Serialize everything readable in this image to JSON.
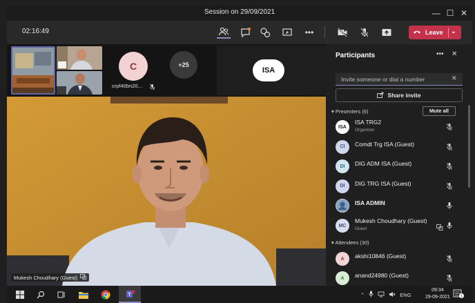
{
  "window": {
    "title": "Session on 29/09/2021",
    "controls": [
      "—",
      "☐",
      "✕"
    ]
  },
  "toolbar": {
    "timer": "02:16:49",
    "leave_label": "Leave",
    "icons": [
      "people-icon",
      "chat-icon",
      "reactions-icon",
      "share-screen-icon",
      "more-icon",
      "camera-off-icon",
      "mic-off-icon",
      "share-tray-icon"
    ]
  },
  "stage": {
    "tile_c": {
      "initial": "C",
      "name": "crpf40bn20..."
    },
    "overflow": "+25",
    "tile_isa": {
      "initial": "ISA"
    },
    "main_speaker": "Mukesh Choudhary (Guest)"
  },
  "panel": {
    "title": "Participants",
    "invite_placeholder": "Invite someone or dial a number",
    "share_invite": "Share invite",
    "presenters_header": "Presenters (6)",
    "mute_all": "Mute all",
    "attendees_header": "Attendees (30)",
    "presenters": [
      {
        "initials": "ISA",
        "name": "ISA TRG2",
        "sub": "Organizer",
        "bg": "#ffffff",
        "fg": "#111111",
        "mic": "muted"
      },
      {
        "initials": "CI",
        "name": "Comdt Trg ISA (Guest)",
        "sub": "",
        "bg": "#cfd6ec",
        "fg": "#3b4a7a",
        "mic": "muted"
      },
      {
        "initials": "DI",
        "name": "DIG ADM ISA (Guest)",
        "sub": "",
        "bg": "#cfe5f0",
        "fg": "#2d6a86",
        "mic": "muted"
      },
      {
        "initials": "DI",
        "name": "DIG TRG ISA (Guest)",
        "sub": "",
        "bg": "#cfd6ec",
        "fg": "#3b4a7a",
        "mic": "muted"
      },
      {
        "initials": "",
        "name": "ISA ADMIN",
        "sub": "",
        "bg": "#7fa3c7",
        "fg": "#ffffff",
        "mic": "on"
      },
      {
        "initials": "MC",
        "name": "Mukesh Choudhary (Guest)",
        "sub": "Guest",
        "bg": "#d9dbf0",
        "fg": "#3b4a7a",
        "mic": "on",
        "sharing": true
      }
    ],
    "attendees": [
      {
        "initials": "A",
        "name": "akshi10846 (Guest)",
        "bg": "#f3d5d5",
        "fg": "#8a3b3b",
        "mic": "muted"
      },
      {
        "initials": "A",
        "name": "anand24980 (Guest)",
        "bg": "#d9ecd6",
        "fg": "#3d7a34",
        "mic": "muted"
      }
    ]
  },
  "taskbar": {
    "lang": "ENG",
    "time": "09:34",
    "date": "29-09-2021",
    "notification_count": "1"
  }
}
